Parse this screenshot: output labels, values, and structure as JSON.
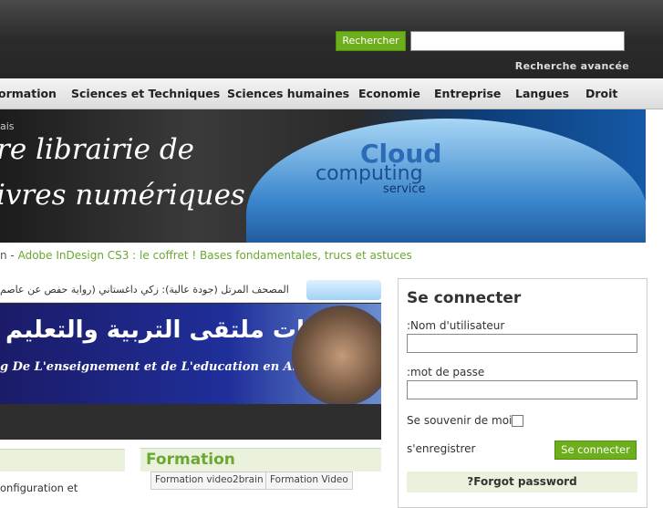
{
  "header": {
    "search_button": "Rechercher",
    "search_value": "",
    "advanced_search": "Recherche avancée"
  },
  "nav": {
    "items": [
      "ormation",
      "Sciences et Techniques",
      "Sciences humaines",
      "Economie",
      "Entreprise",
      "Langues",
      "Droit"
    ]
  },
  "banner": {
    "small": "ais",
    "line1": "re librairie de",
    "line2": "ivres numériques",
    "cloud_title": "Cloud",
    "cloud_sub": "computing",
    "cloud_service": "service"
  },
  "breadcrumb": {
    "prefix": "n - ",
    "link": "Adobe InDesign CS3 : le coffret ! Bases fondamentales, trucs et astuces"
  },
  "ticker": {
    "text": "المصحف المرتل (جودة عالية): زكي داغستاني (رواية حفص عن عاصم"
  },
  "ad": {
    "arabic": "منتديات ملتقى التربية والتعليم",
    "french": "g De L'enseignement et de L'education en Algerie"
  },
  "left_box": {
    "text": "onfiguration et"
  },
  "formation": {
    "title": "Formation",
    "tags": [
      "Formation video2brain",
      "Formation Video"
    ]
  },
  "login": {
    "title": "Se connecter",
    "username_label": ":Nom d'utilisateur",
    "password_label": ":mot de passe",
    "remember_label": "Se souvenir de moi",
    "register_link": "s'enregistrer",
    "submit_button": "Se connecter",
    "forgot_link": "?Forgot password"
  },
  "colors": {
    "accent_green": "#6cae1b",
    "link_green": "#6aa832",
    "header_dark": "#2b2b2b"
  }
}
